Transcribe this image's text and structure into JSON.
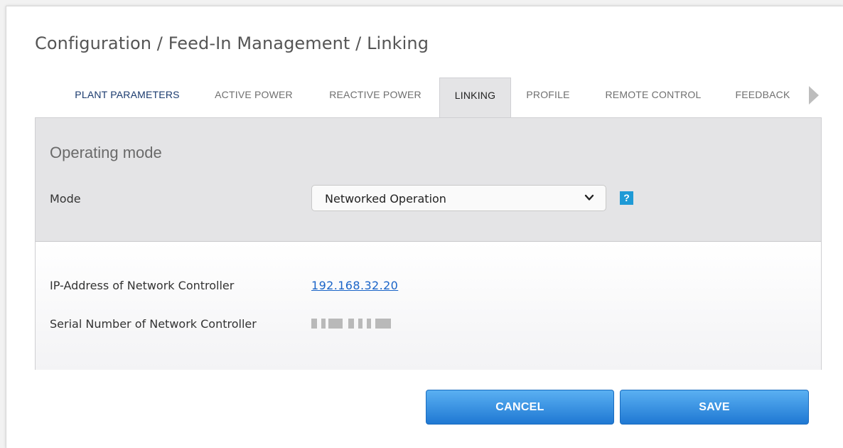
{
  "page": {
    "title": "Configuration / Feed-In Management / Linking"
  },
  "tabs": [
    {
      "label": "PLANT PARAMETERS",
      "state": "selected-link"
    },
    {
      "label": "ACTIVE POWER",
      "state": "normal"
    },
    {
      "label": "REACTIVE POWER",
      "state": "normal"
    },
    {
      "label": "LINKING",
      "state": "active"
    },
    {
      "label": "PROFILE",
      "state": "normal"
    },
    {
      "label": "REMOTE CONTROL",
      "state": "normal"
    },
    {
      "label": "FEEDBACK",
      "state": "normal"
    }
  ],
  "tab_scroll_icon": "triangle-right-icon",
  "operating_mode": {
    "title": "Operating mode",
    "mode_label": "Mode",
    "mode_value": "Networked Operation",
    "help_label": "?"
  },
  "network": {
    "ip_label": "IP-Address of Network Controller",
    "ip_value": "192.168.32.20",
    "serial_label": "Serial Number of Network Controller"
  },
  "buttons": {
    "cancel": "CANCEL",
    "save": "SAVE"
  },
  "colors": {
    "accent": "#1f78d3",
    "link": "#1a64c8",
    "help": "#1e9ad6",
    "panel_bg": "#e4e4e6"
  }
}
